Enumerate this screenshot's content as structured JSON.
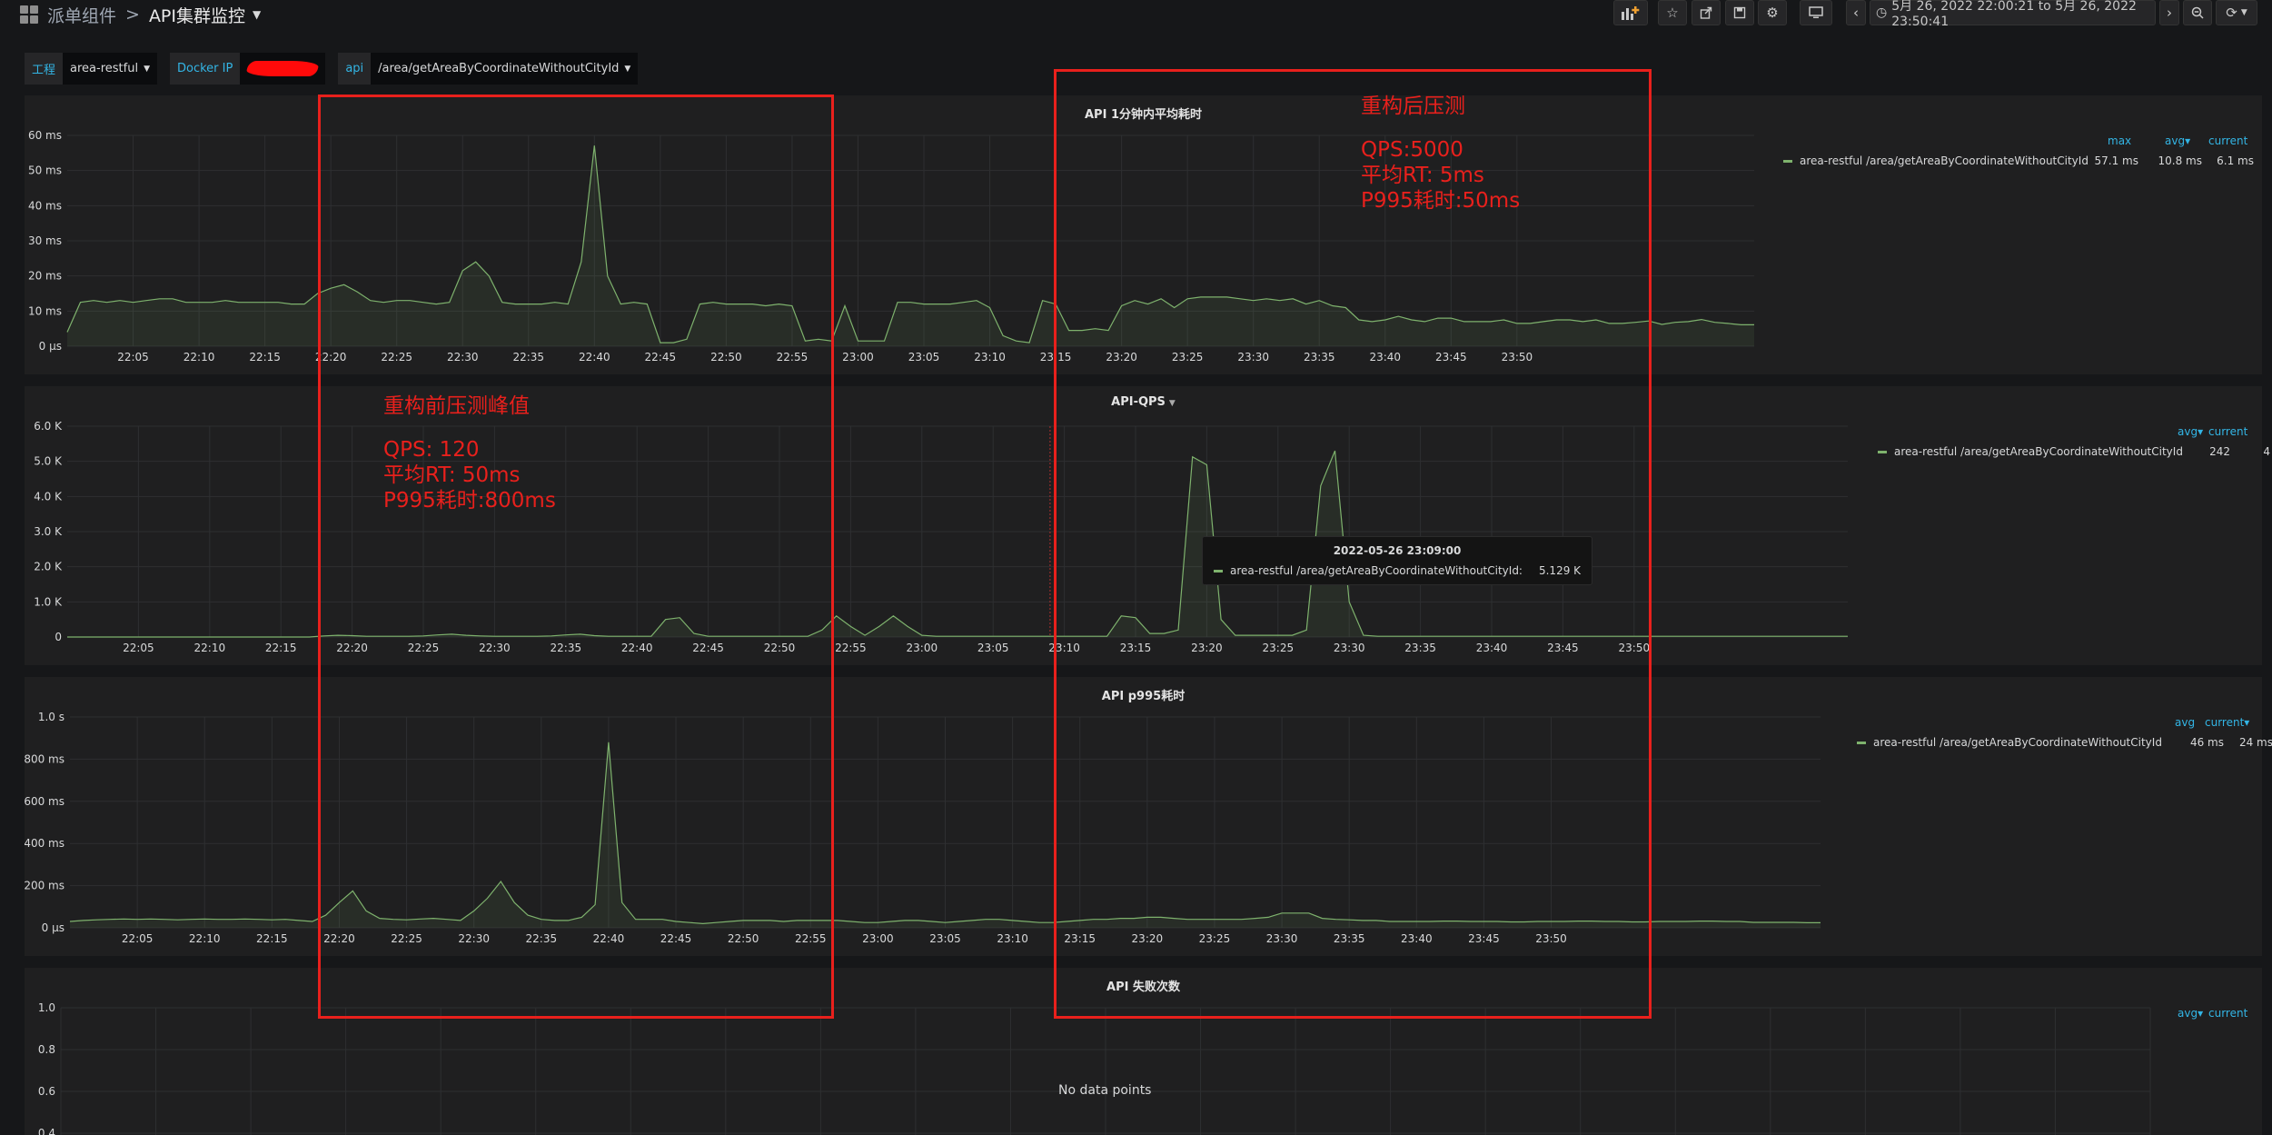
{
  "breadcrumb": {
    "folder": "派单组件",
    "separator": ">",
    "title": "API集群监控"
  },
  "toolbar": {
    "icons": [
      "add-panel-icon",
      "star-icon",
      "share-icon",
      "save-icon",
      "settings-icon",
      "tv-icon",
      "chevron-left-icon",
      "chevron-right-icon",
      "zoom-out-icon",
      "refresh-icon"
    ],
    "time_range": "5月 26, 2022 22:00:21 to 5月 26, 2022 23:50:41"
  },
  "variables": [
    {
      "label": "工程",
      "value": "area-restful"
    },
    {
      "label": "Docker IP",
      "value": ""
    },
    {
      "label": "api",
      "value": "/area/getAreaByCoordinateWithoutCityId"
    }
  ],
  "series_color": "#7eb26d",
  "annotation_color": "#e8201c",
  "panels": {
    "avg": {
      "title": "API 1分钟内平均耗时",
      "legend_headers": [
        "max",
        "avg",
        "current"
      ],
      "legend_rows": [
        {
          "name": "area-restful /area/getAreaByCoordinateWithoutCityId",
          "values": [
            "57.1 ms",
            "10.8 ms",
            "6.1 ms"
          ]
        }
      ],
      "chart_data": {
        "type": "area",
        "x_start": "22:00",
        "x_step_minutes": 1,
        "xticks": [
          "22:05",
          "22:10",
          "22:15",
          "22:20",
          "22:25",
          "22:30",
          "22:35",
          "22:40",
          "22:45",
          "22:50",
          "22:55",
          "23:00",
          "23:05",
          "23:10",
          "23:15",
          "23:20",
          "23:25",
          "23:30",
          "23:35",
          "23:40",
          "23:45",
          "23:50"
        ],
        "yticks": [
          "0 μs",
          "10 ms",
          "20 ms",
          "30 ms",
          "40 ms",
          "50 ms",
          "60 ms"
        ],
        "ylim": [
          0,
          60
        ],
        "yunit": "ms",
        "series": [
          {
            "name": "area-restful /area/getAreaByCoordinateWithoutCityId",
            "values": [
              4,
              12.5,
              13,
              12.5,
              13,
              12.5,
              13,
              13.5,
              13.5,
              12.5,
              12.5,
              12.5,
              13,
              12.5,
              12.5,
              12.5,
              12.5,
              12,
              12,
              15,
              16.5,
              17.5,
              15.5,
              13,
              12.5,
              13,
              13,
              12.5,
              12,
              12.5,
              21.5,
              24,
              20,
              12.5,
              12,
              12,
              12,
              12.5,
              12,
              24,
              57.1,
              20,
              12,
              12.5,
              12,
              1,
              1,
              2,
              12,
              12.5,
              12,
              12,
              12,
              11.5,
              12,
              11.5,
              1.5,
              2,
              1.5,
              11.5,
              1.5,
              1.5,
              1.5,
              12.5,
              12.5,
              12,
              12,
              12,
              12.5,
              13,
              11,
              3,
              1.5,
              1,
              13,
              12,
              4.5,
              4.5,
              5,
              4.5,
              11.5,
              13,
              12,
              13.5,
              11,
              13.5,
              14,
              14,
              14,
              13.5,
              13,
              13.5,
              13,
              13.5,
              12,
              13,
              11.5,
              11,
              7.5,
              7,
              7.5,
              8.5,
              7.5,
              7,
              8,
              8,
              7,
              7,
              7,
              7.5,
              6.5,
              6.5,
              7,
              7.5,
              7.5,
              7,
              7.5,
              6.5,
              6.5,
              6.8,
              7.2,
              6.2,
              6.8,
              7,
              7.6,
              6.8,
              6.5,
              6.1,
              6.1
            ]
          }
        ]
      }
    },
    "qps": {
      "title": "API-QPS",
      "legend_headers": [
        "avg",
        "current"
      ],
      "legend_rows": [
        {
          "name": "area-restful /area/getAreaByCoordinateWithoutCityId",
          "values": [
            "242",
            "4"
          ]
        }
      ],
      "tooltip": {
        "time": "2022-05-26 23:09:00",
        "name": "area-restful /area/getAreaByCoordinateWithoutCityId:",
        "value": "5.129 K"
      },
      "chart_data": {
        "type": "area",
        "x_start": "22:00",
        "x_step_minutes": 1,
        "xticks": [
          "22:05",
          "22:10",
          "22:15",
          "22:20",
          "22:25",
          "22:30",
          "22:35",
          "22:40",
          "22:45",
          "22:50",
          "22:55",
          "23:00",
          "23:05",
          "23:10",
          "23:15",
          "23:20",
          "23:25",
          "23:30",
          "23:35",
          "23:40",
          "23:45",
          "23:50"
        ],
        "yticks": [
          "0",
          "1.0 K",
          "2.0 K",
          "3.0 K",
          "4.0 K",
          "5.0 K",
          "6.0 K"
        ],
        "ylim": [
          0,
          6000
        ],
        "series": [
          {
            "name": "area-restful /area/getAreaByCoordinateWithoutCityId",
            "values": [
              0,
              0,
              0,
              0,
              0,
              0,
              0,
              0,
              0,
              0,
              0,
              0,
              0,
              0,
              0,
              0,
              0,
              0,
              30,
              50,
              40,
              20,
              20,
              20,
              20,
              30,
              60,
              80,
              50,
              30,
              20,
              20,
              20,
              20,
              30,
              60,
              80,
              40,
              20,
              20,
              20,
              20,
              500,
              550,
              100,
              20,
              20,
              20,
              20,
              20,
              20,
              20,
              20,
              200,
              600,
              300,
              50,
              300,
              600,
              300,
              50,
              20,
              20,
              20,
              20,
              20,
              20,
              20,
              20,
              20,
              20,
              20,
              20,
              20,
              600,
              550,
              100,
              100,
              200,
              5129,
              4900,
              500,
              50,
              50,
              50,
              50,
              50,
              200,
              4300,
              5300,
              1000,
              50,
              20,
              20,
              20,
              20,
              20,
              20,
              20,
              20,
              20,
              20,
              20,
              20,
              20,
              20,
              20,
              20,
              20,
              20,
              20,
              20,
              20,
              20,
              20,
              20,
              20,
              20,
              20,
              20,
              20,
              20,
              20,
              20,
              20,
              20
            ]
          }
        ]
      }
    },
    "p995": {
      "title": "API p995耗时",
      "legend_headers": [
        "avg",
        "current"
      ],
      "legend_rows": [
        {
          "name": "area-restful /area/getAreaByCoordinateWithoutCityId",
          "values": [
            "46 ms",
            "24 ms"
          ]
        }
      ],
      "chart_data": {
        "type": "area",
        "x_start": "22:00",
        "x_step_minutes": 1,
        "xticks": [
          "22:05",
          "22:10",
          "22:15",
          "22:20",
          "22:25",
          "22:30",
          "22:35",
          "22:40",
          "22:45",
          "22:50",
          "22:55",
          "23:00",
          "23:05",
          "23:10",
          "23:15",
          "23:20",
          "23:25",
          "23:30",
          "23:35",
          "23:40",
          "23:45",
          "23:50"
        ],
        "yticks": [
          "0 μs",
          "200 ms",
          "400 ms",
          "600 ms",
          "800 ms",
          "1.0 s"
        ],
        "ylim": [
          0,
          1000
        ],
        "yunit": "ms",
        "series": [
          {
            "name": "area-restful /area/getAreaByCoordinateWithoutCityId",
            "values": [
              30,
              35,
              38,
              40,
              42,
              40,
              42,
              40,
              38,
              40,
              42,
              40,
              40,
              42,
              40,
              38,
              40,
              35,
              30,
              60,
              120,
              175,
              80,
              45,
              40,
              38,
              42,
              45,
              40,
              35,
              80,
              140,
              220,
              120,
              60,
              40,
              35,
              35,
              50,
              110,
              880,
              120,
              40,
              40,
              40,
              30,
              25,
              20,
              25,
              30,
              35,
              35,
              35,
              30,
              35,
              35,
              35,
              35,
              30,
              25,
              25,
              30,
              35,
              35,
              30,
              25,
              30,
              35,
              40,
              40,
              35,
              30,
              25,
              25,
              30,
              35,
              40,
              40,
              45,
              45,
              50,
              50,
              45,
              40,
              40,
              40,
              40,
              40,
              45,
              50,
              70,
              70,
              70,
              45,
              40,
              38,
              35,
              35,
              30,
              30,
              30,
              30,
              32,
              32,
              30,
              30,
              30,
              28,
              28,
              30,
              30,
              30,
              32,
              32,
              30,
              30,
              28,
              28,
              30,
              30,
              30,
              32,
              32,
              30,
              30,
              26,
              26,
              26,
              26,
              24,
              24
            ]
          }
        ]
      }
    },
    "fail": {
      "title": "API 失败次数",
      "legend_headers": [
        "avg",
        "current"
      ],
      "no_data": "No data points",
      "chart_data": {
        "type": "line",
        "yticks": [
          "0.4",
          "0.6",
          "0.8",
          "1.0"
        ],
        "series": []
      }
    }
  },
  "annotations": {
    "before": {
      "title": "重构前压测峰值",
      "lines": [
        "QPS: 120",
        "平均RT: 50ms",
        "P995耗时:800ms"
      ]
    },
    "after": {
      "title": "重构后压测",
      "lines": [
        "QPS:5000",
        "平均RT: 5ms",
        "P995耗时:50ms"
      ]
    }
  }
}
